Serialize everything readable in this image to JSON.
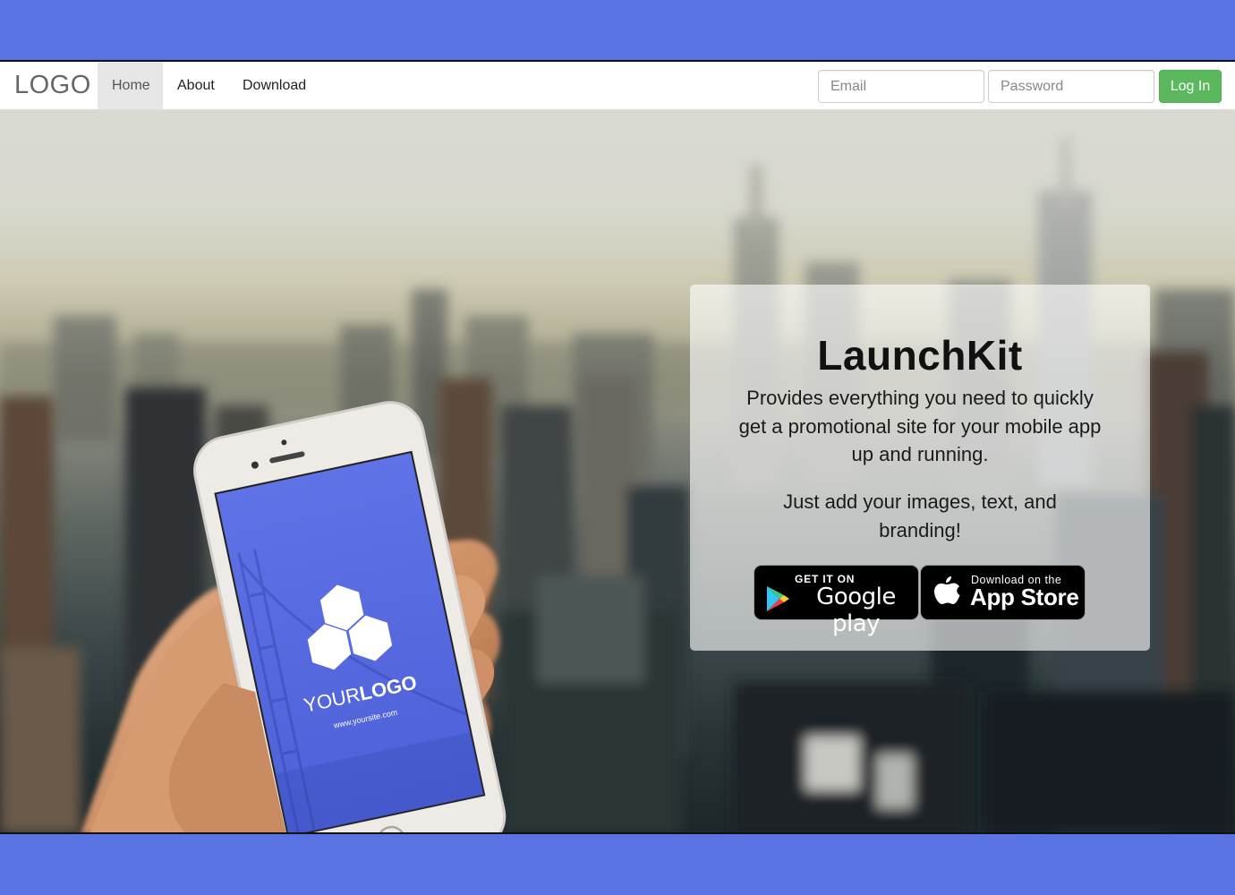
{
  "navbar": {
    "brand": "LOGO",
    "items": [
      {
        "label": "Home"
      },
      {
        "label": "About"
      },
      {
        "label": "Download"
      }
    ],
    "email_placeholder": "Email",
    "password_placeholder": "Password",
    "login_label": "Log In"
  },
  "hero": {
    "title": "LaunchKit",
    "description": "Provides everything you need to quickly get a promotional site for your mobile app up and running.",
    "description2": "Just add your images, text, and branding!",
    "google_play": {
      "small": "GET IT ON",
      "big": "Google play"
    },
    "app_store": {
      "small": "Download on the",
      "big": "App Store"
    },
    "phone_screen": {
      "logo_light": "YOUR",
      "logo_bold": "LOGO",
      "url": "www.yoursite.com"
    }
  },
  "colors": {
    "page_background": "#5a73e3",
    "login_button": "#5cb85c",
    "phone_screen": "#5468e0",
    "active_nav_bg": "#e6e6e6"
  },
  "icons": [
    "google-play-icon",
    "apple-icon",
    "hexagon-logo-icon"
  ]
}
